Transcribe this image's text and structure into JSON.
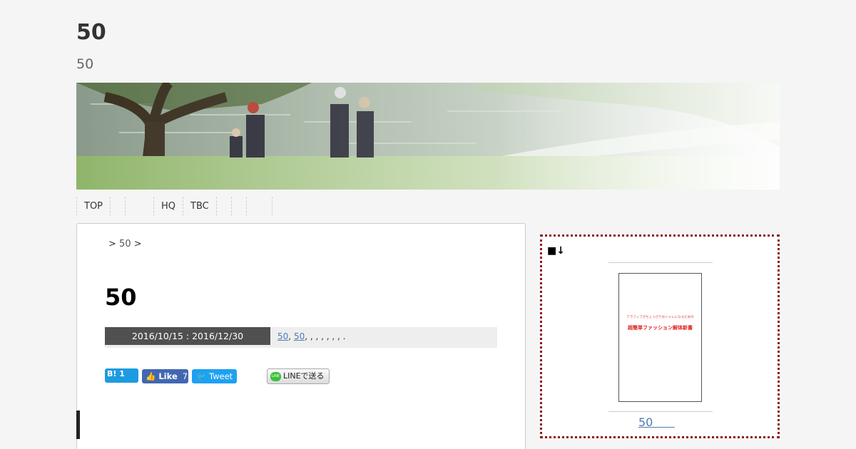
{
  "site": {
    "title": "50",
    "description": "50"
  },
  "nav": [
    "TOP",
    "",
    "",
    "HQ",
    "TBC",
    "",
    "",
    ""
  ],
  "breadcrumb": {
    "prefix": ">",
    "link": "50",
    "suffix": ">"
  },
  "post": {
    "title": "50",
    "date": "2016/10/15 : 2016/12/30",
    "tag1": "50",
    "sep1": ",",
    "tag2": "50",
    "rest": ", , , , , , , ."
  },
  "share": {
    "hatena_label": "B!",
    "hatena_count": "1",
    "like_label": "Like",
    "like_count": "7",
    "tweet_label": "Tweet",
    "line_icon_text": "LINE",
    "line_label": "LINEで送る"
  },
  "sidebar": {
    "heading": "■↓",
    "book_subtitle": "アラフィフがちょっぴりおシャレになるための",
    "book_title": "超簡単ファッション解体新書",
    "link_text": "50      "
  }
}
